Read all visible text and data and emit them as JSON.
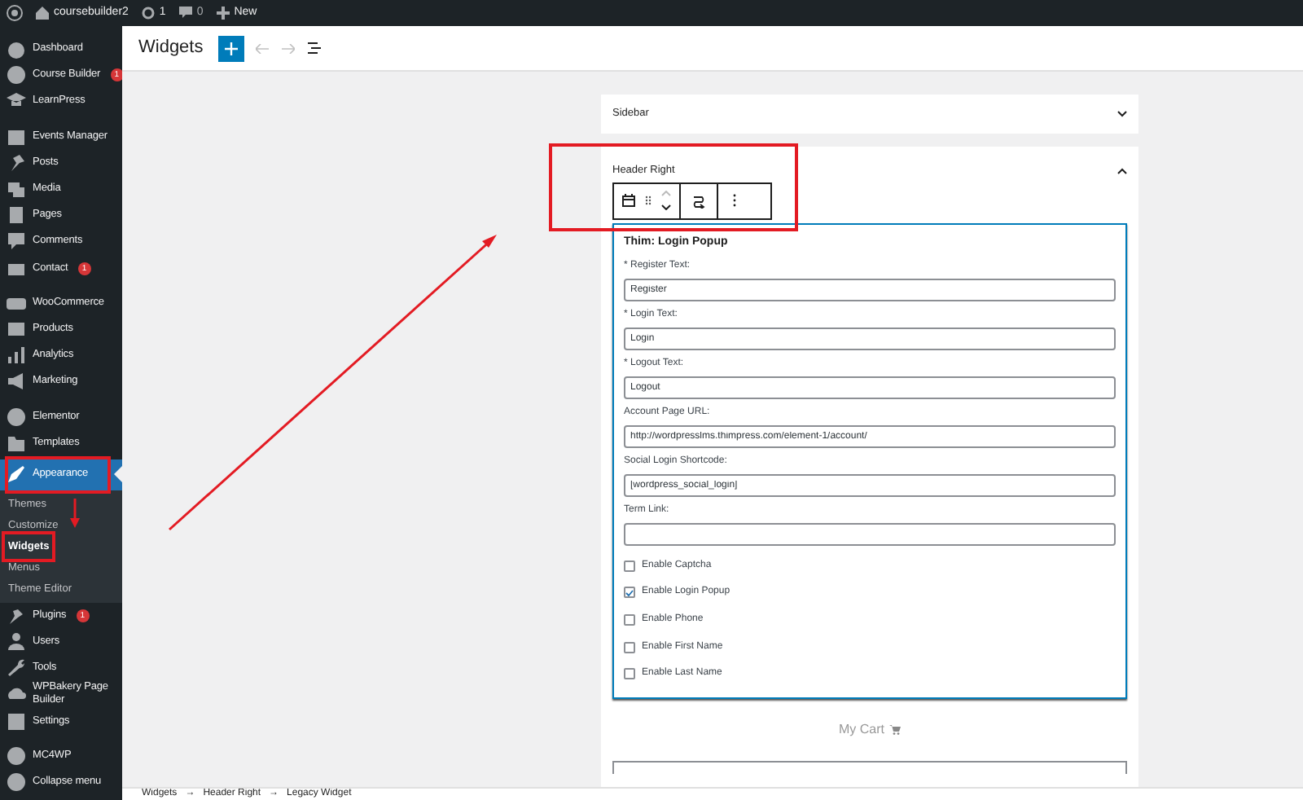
{
  "admin_bar": {
    "site": "coursebuilder2",
    "updates": "1",
    "comments": "0",
    "new": "New"
  },
  "sidebar": {
    "groups": [
      {
        "items": [
          {
            "label": "Dashboard",
            "selected": false
          },
          {
            "label": "Course Builder",
            "badge": "1",
            "selected": false
          },
          {
            "label": "LearnPress",
            "selected": false
          }
        ]
      },
      {
        "items": [
          {
            "label": "Events Manager",
            "selected": false
          },
          {
            "label": "Posts",
            "selected": false
          },
          {
            "label": "Media",
            "selected": false
          },
          {
            "label": "Pages",
            "selected": false
          },
          {
            "label": "Comments",
            "selected": false
          },
          {
            "label": "Contact",
            "badge": "1",
            "selected": false
          }
        ]
      },
      {
        "items": [
          {
            "label": "WooCommerce",
            "selected": false
          },
          {
            "label": "Products",
            "selected": false
          },
          {
            "label": "Analytics",
            "selected": false
          },
          {
            "label": "Marketing",
            "selected": false
          }
        ]
      },
      {
        "items": [
          {
            "label": "Elementor",
            "selected": false
          },
          {
            "label": "Templates",
            "selected": false
          },
          {
            "label": "Appearance",
            "selected": true,
            "submenu": [
              {
                "label": "Themes",
                "selected": false
              },
              {
                "label": "Customize",
                "selected": false
              },
              {
                "label": "Widgets",
                "selected": true
              },
              {
                "label": "Menus",
                "selected": false
              },
              {
                "label": "Theme Editor",
                "selected": false
              }
            ]
          },
          {
            "label": "Plugins",
            "badge": "1",
            "selected": false
          },
          {
            "label": "Users",
            "selected": false
          },
          {
            "label": "Tools",
            "selected": false
          },
          {
            "label": "WPBakery Page Builder",
            "selected": false
          },
          {
            "label": "Settings",
            "selected": false
          }
        ]
      },
      {
        "items": [
          {
            "label": "MC4WP",
            "selected": false
          },
          {
            "label": "Collapse menu",
            "selected": false
          }
        ]
      }
    ]
  },
  "header": {
    "title": "Widgets"
  },
  "widget_areas": [
    {
      "title": "Sidebar",
      "expanded": false
    },
    {
      "title": "Header Right",
      "expanded": true,
      "widget": {
        "title": "Thim: Login Popup",
        "fields": [
          {
            "label": "* Register Text:",
            "value": "Register"
          },
          {
            "label": "* Login Text:",
            "value": "Login"
          },
          {
            "label": "* Logout Text:",
            "value": "Logout"
          },
          {
            "label": "Account Page URL:",
            "value": "http://wordpresslms.thimpress.com/element-1/account/"
          },
          {
            "label": "Social Login Shortcode:",
            "value": "[wordpress_social_login]"
          },
          {
            "label": "Term Link:"
          }
        ],
        "checkboxes": [
          {
            "label": "Enable Captcha",
            "checked": false
          },
          {
            "label": "Enable Login Popup",
            "checked": true
          },
          {
            "label": "Enable Phone",
            "checked": false
          },
          {
            "label": "Enable First Name",
            "checked": false
          },
          {
            "label": "Enable Last Name",
            "checked": false
          }
        ]
      },
      "below": {
        "text": "My Cart"
      }
    }
  ],
  "breadcrumb": {
    "items": [
      "Widgets",
      "Header Right",
      "Legacy Widget"
    ],
    "separator": "→"
  }
}
